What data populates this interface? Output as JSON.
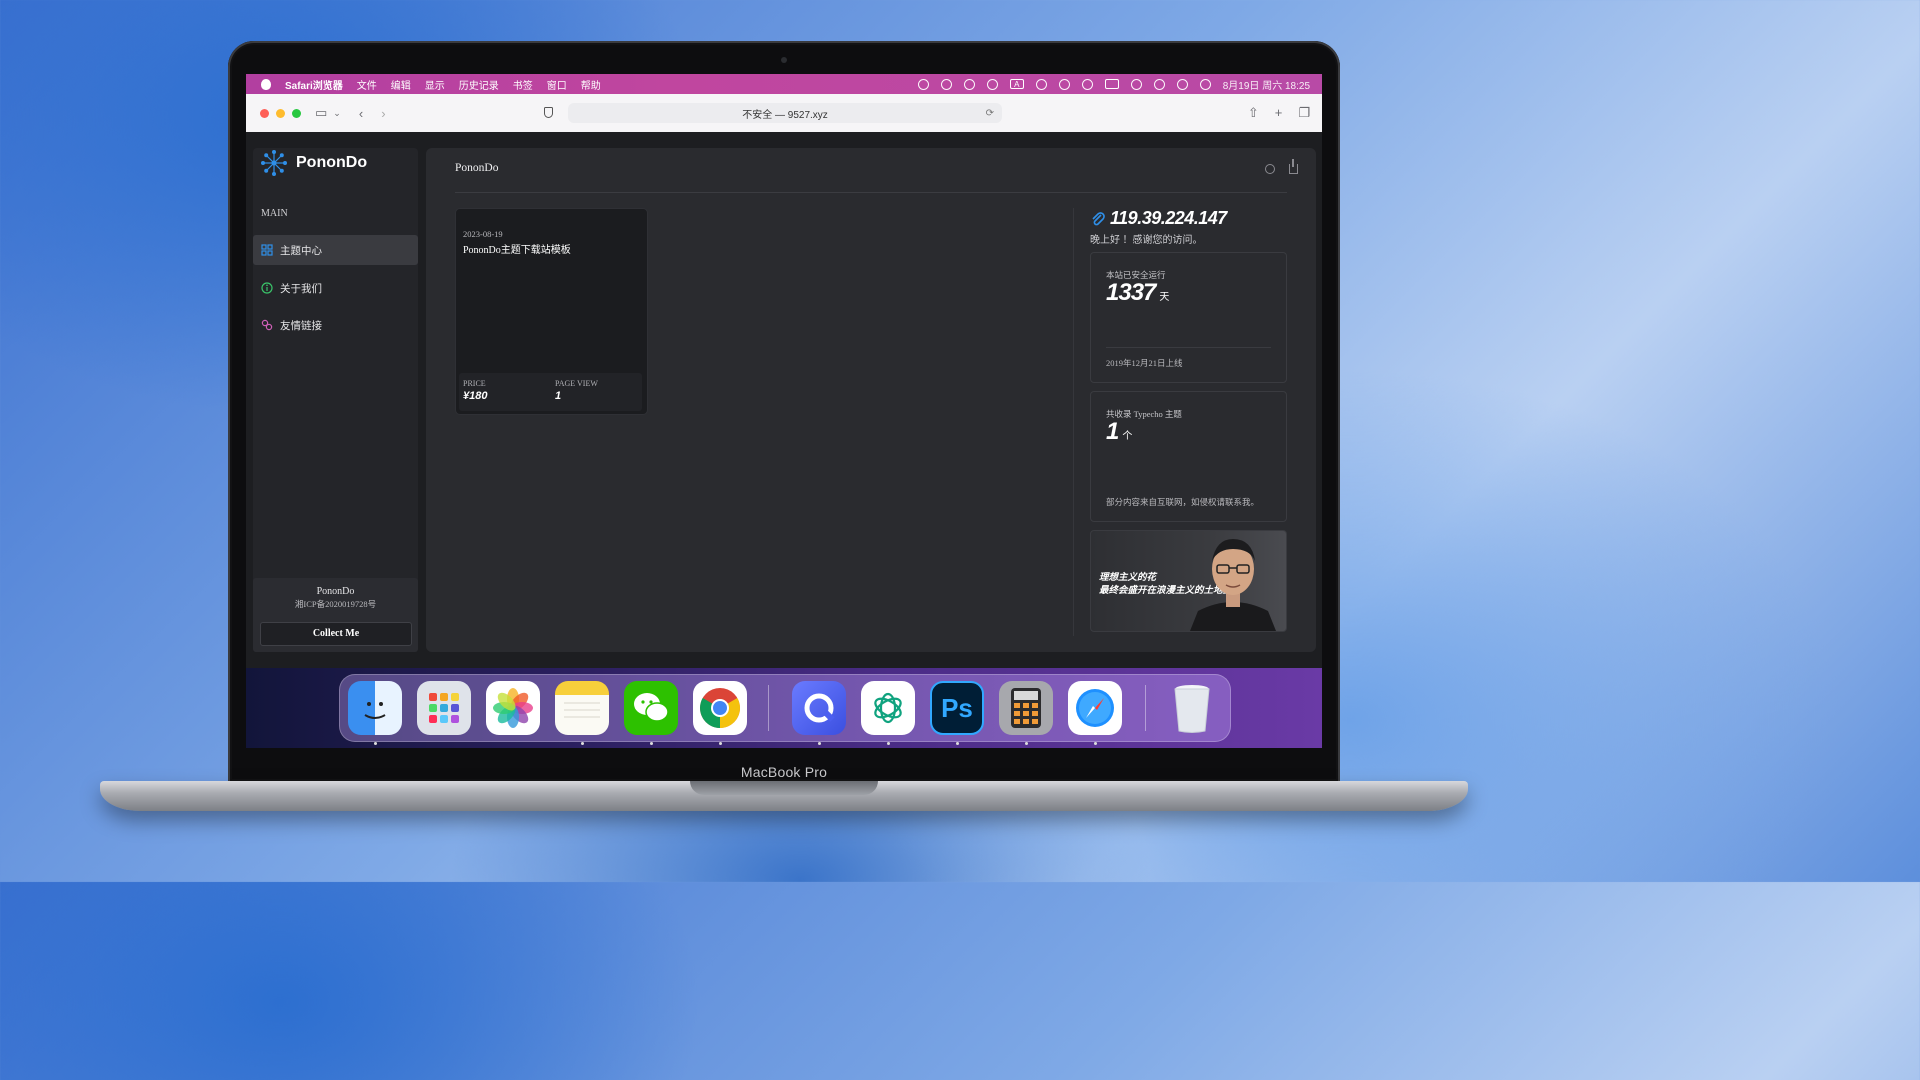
{
  "device": {
    "label": "MacBook Pro"
  },
  "menubar": {
    "app_name": "Safari浏览器",
    "menus": [
      "文件",
      "编辑",
      "显示",
      "历史记录",
      "书签",
      "窗口",
      "帮助"
    ],
    "input_indicator": "A",
    "datetime": "8月19日 周六 18:25"
  },
  "browser": {
    "address": "不安全 — 9527.xyz"
  },
  "site": {
    "logo_text": "PononDo",
    "section_label": "MAIN",
    "nav": [
      {
        "label": "主题中心",
        "icon": "grid-icon",
        "active": true
      },
      {
        "label": "关于我们",
        "icon": "info-icon",
        "active": false
      },
      {
        "label": "友情链接",
        "icon": "link-icon",
        "active": false
      }
    ],
    "footer": {
      "name": "PononDo",
      "icp": "湘ICP备2020019728号",
      "button": "Collect Me"
    }
  },
  "main": {
    "title": "PononDo",
    "card": {
      "date": "2023-08-19",
      "title": "PononDo主题下载站模板",
      "price_label": "PRICE",
      "price_value": "¥180",
      "pv_label": "PAGE VIEW",
      "pv_value": "1"
    },
    "side": {
      "ip": "119.39.224.147",
      "greeting": "晚上好 ！感谢您的访问。",
      "uptime_label": "本站已安全运行",
      "uptime_value": "1337",
      "uptime_unit": "天",
      "launch_date": "2019年12月21日上线",
      "themes_label": "共收录 Typecho 主题",
      "themes_value": "1",
      "themes_unit": "个",
      "disclaimer": "部分内容来自互联网，如侵权请联系我。",
      "quote_line1": "理想主义的花",
      "quote_line2": "最终会盛开在浪漫主义的土地里"
    }
  },
  "dock": {
    "apps": [
      "finder-icon",
      "launchpad-icon",
      "photos-icon",
      "notes-icon",
      "wechat-icon",
      "chrome-icon",
      "quark-icon",
      "chatgpt-icon",
      "photoshop-icon",
      "calculator-icon",
      "safari-icon",
      "trash-icon"
    ],
    "photoshop_label": "Ps"
  },
  "colors": {
    "menubar": "#b23fa0",
    "accent_blue": "#2f8fe8",
    "page_bg": "#1d1e21"
  }
}
